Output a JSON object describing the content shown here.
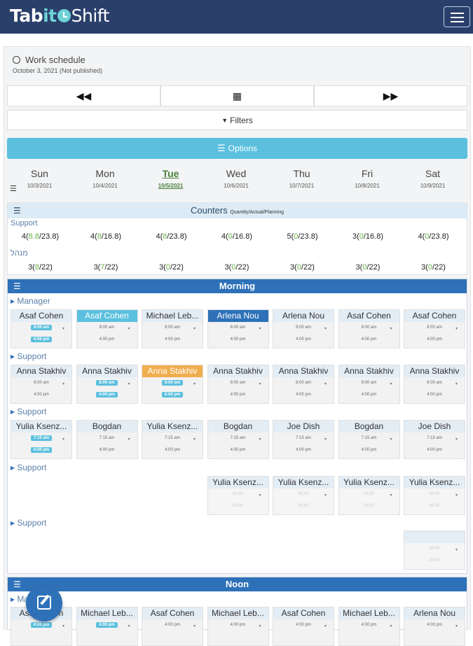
{
  "app": {
    "logo_a": "Tab",
    "logo_b": "it",
    "logo_c": "Shift"
  },
  "schedule": {
    "title": "Work schedule",
    "date": "October 3, 2021 (Not published)"
  },
  "filters_label": "Filters",
  "options_label": "Options",
  "days": [
    {
      "name": "Sun",
      "date": "10/3/2021"
    },
    {
      "name": "Mon",
      "date": "10/4/2021"
    },
    {
      "name": "Tue",
      "date": "10/5/2021",
      "today": true
    },
    {
      "name": "Wed",
      "date": "10/6/2021"
    },
    {
      "name": "Thu",
      "date": "10/7/2021"
    },
    {
      "name": "Fri",
      "date": "10/8/2021"
    },
    {
      "name": "Sat",
      "date": "10/9/2021"
    }
  ],
  "counters": {
    "title": "Counters",
    "subtitle": "Quantity/Actual/Planning",
    "rows": [
      {
        "label": "Support",
        "values": [
          [
            "4(",
            "8.8",
            "/23.8)"
          ],
          [
            "4(",
            "8",
            "/16.8)"
          ],
          [
            "4(",
            "8",
            "/23.8)"
          ],
          [
            "4(",
            "0",
            "/16.8)"
          ],
          [
            "5(",
            "0",
            "/23.8)"
          ],
          [
            "3(",
            "0",
            "/16.8)"
          ],
          [
            "4(",
            "0",
            "/23.8)"
          ]
        ]
      },
      {
        "label": "מנהל",
        "values": [
          [
            "3(",
            "8",
            "/22)"
          ],
          [
            "3(",
            "7",
            "/22)"
          ],
          [
            "3(",
            "0",
            "/22)"
          ],
          [
            "3(",
            "0",
            "/22)"
          ],
          [
            "3(",
            "0",
            "/22)"
          ],
          [
            "3(",
            "0",
            "/22)"
          ],
          [
            "3(",
            "0",
            "/22)"
          ]
        ]
      }
    ]
  },
  "morning": {
    "title": "Morning",
    "groups": [
      {
        "label": "Manager",
        "cards": [
          {
            "name": "Asaf Cohen",
            "start": "8:00 am",
            "end": "4:00 pm",
            "tag": true
          },
          {
            "name": "Asaf Cohen",
            "start": "8:00 am",
            "end": "4:00 pm",
            "style": "blue"
          },
          {
            "name": "Michael Leb...",
            "start": "8:00 am",
            "end": "4:00 pm"
          },
          {
            "name": "Arlena Nou",
            "start": "8:00 am",
            "end": "4:00 pm",
            "style": "dark"
          },
          {
            "name": "Arlena Nou",
            "start": "8:00 am",
            "end": "4:00 pm"
          },
          {
            "name": "Asaf Cohen",
            "start": "8:00 am",
            "end": "4:00 pm"
          },
          {
            "name": "Asaf Cohen",
            "start": "8:00 am",
            "end": "4:00 pm"
          }
        ]
      },
      {
        "label": "Support",
        "cards": [
          {
            "name": "Anna Stakhiv",
            "start": "8:00 am",
            "end": "4:00 pm"
          },
          {
            "name": "Anna Stakhiv",
            "start": "8:00 am",
            "end": "4:00 pm",
            "tag": true
          },
          {
            "name": "Anna Stakhiv",
            "start": "8:00 am",
            "end": "4:00 pm",
            "style": "orange",
            "tag": true
          },
          {
            "name": "Anna Stakhiv",
            "start": "8:00 am",
            "end": "4:00 pm"
          },
          {
            "name": "Anna Stakhiv",
            "start": "8:00 am",
            "end": "4:00 pm"
          },
          {
            "name": "Anna Stakhiv",
            "start": "8:00 am",
            "end": "4:00 pm"
          },
          {
            "name": "Anna Stakhiv",
            "start": "8:00 am",
            "end": "4:00 pm"
          }
        ]
      },
      {
        "label": "Support",
        "cards": [
          {
            "name": "Yulia Ksenz...",
            "start": "7:15 am",
            "end": "4:00 pm",
            "tag": true
          },
          {
            "name": "Bogdan",
            "start": "7:15 am",
            "end": "4:00 pm"
          },
          {
            "name": "Yulia Ksenz...",
            "start": "7:15 am",
            "end": "4:00 pm"
          },
          {
            "name": "Bogdan",
            "start": "7:15 am",
            "end": "4:00 pm"
          },
          {
            "name": "Joe Dish",
            "start": "7:15 am",
            "end": "4:00 pm"
          },
          {
            "name": "Bogdan",
            "start": "7:15 am",
            "end": "4:00 pm"
          },
          {
            "name": "Joe Dish",
            "start": "7:15 am",
            "end": "4:00 pm"
          }
        ]
      },
      {
        "label": "Support",
        "cards": [
          null,
          null,
          null,
          {
            "name": "Yulia Ksenz...",
            "start": "00:00",
            "end": "00:00",
            "faded": true
          },
          {
            "name": "Yulia Ksenz...",
            "start": "00:00",
            "end": "00:00",
            "faded": true
          },
          {
            "name": "Yulia Ksenz...",
            "start": "00:00",
            "end": "00:00",
            "faded": true
          },
          {
            "name": "Yulia Ksenz...",
            "start": "00:00",
            "end": "00:00",
            "faded": true
          }
        ]
      },
      {
        "label": "Support",
        "cards": [
          null,
          null,
          null,
          null,
          null,
          null,
          {
            "name": "",
            "start": "00:00",
            "end": "00:00",
            "faded": true
          }
        ]
      }
    ]
  },
  "noon": {
    "title": "Noon",
    "group_label": "Manager",
    "cards": [
      {
        "name": "Asaf Cohen",
        "start": "4:00 pm",
        "tag": true
      },
      {
        "name": "Michael Leb...",
        "start": "4:00 pm",
        "tag": true
      },
      {
        "name": "Asaf Cohen",
        "start": "4:00 pm"
      },
      {
        "name": "Michael Leb...",
        "start": "4:00 pm"
      },
      {
        "name": "Asaf Cohen",
        "start": "4:00 pm"
      },
      {
        "name": "Michael Leb...",
        "start": "4:00 pm"
      },
      {
        "name": "Arlena Nou",
        "start": "4:00 pm"
      }
    ]
  }
}
